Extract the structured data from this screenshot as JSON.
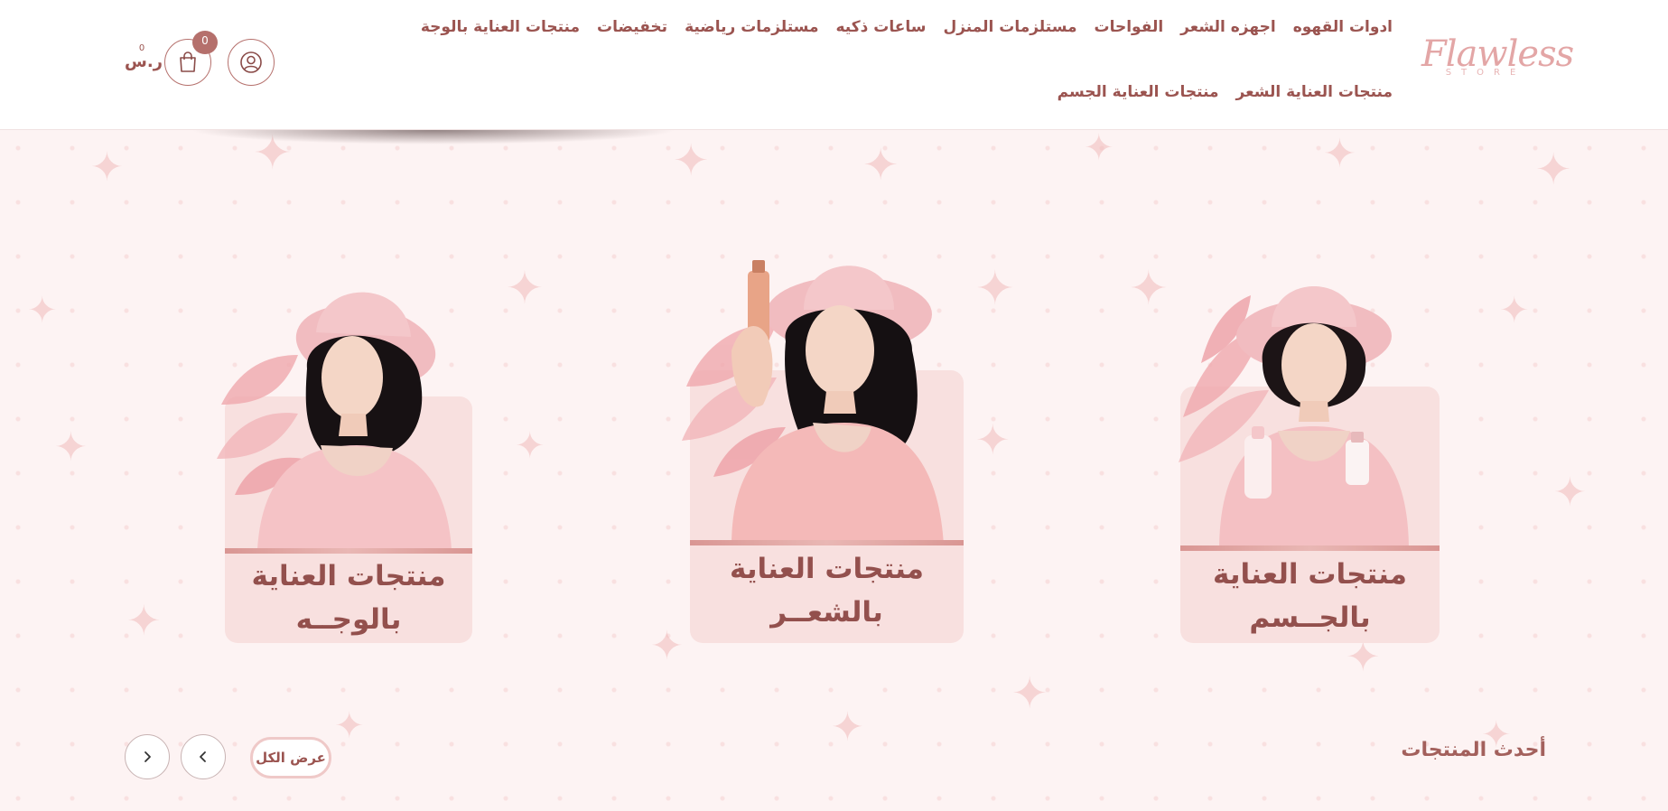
{
  "header": {
    "logo": {
      "main": "Flawless",
      "sub": "STORE"
    },
    "nav": [
      "ادوات القهوه",
      "اجهزه الشعر",
      "الفواحات",
      "مستلزمات المنزل",
      "ساعات ذكيه",
      "مستلزمات رياضية",
      "تخفيضات",
      "منتجات العناية بالوجة",
      "منتجات العناية الشعر",
      "منتجات العناية الجسم"
    ],
    "cart": {
      "badge": "0",
      "amount": "0",
      "currency": "ر.س"
    }
  },
  "categories": [
    {
      "line1": "منتجات العناية",
      "line2": "بالجــسم"
    },
    {
      "line1": "منتجات العناية",
      "line2": "بالشعــر"
    },
    {
      "line1": "منتجات العناية",
      "line2": "بالوجــه"
    }
  ],
  "latest": {
    "title": "أحدث المنتجات",
    "view_all": "عرض الكل"
  },
  "colors": {
    "brand": "#9b5450",
    "accent": "#b5706c",
    "card_bg": "#f8e0df",
    "page_bg": "#fdf3f3",
    "logo": "#e3a6a6"
  },
  "icons": [
    "user-icon",
    "shopping-bag-icon",
    "chevron-left-icon",
    "chevron-right-icon"
  ]
}
